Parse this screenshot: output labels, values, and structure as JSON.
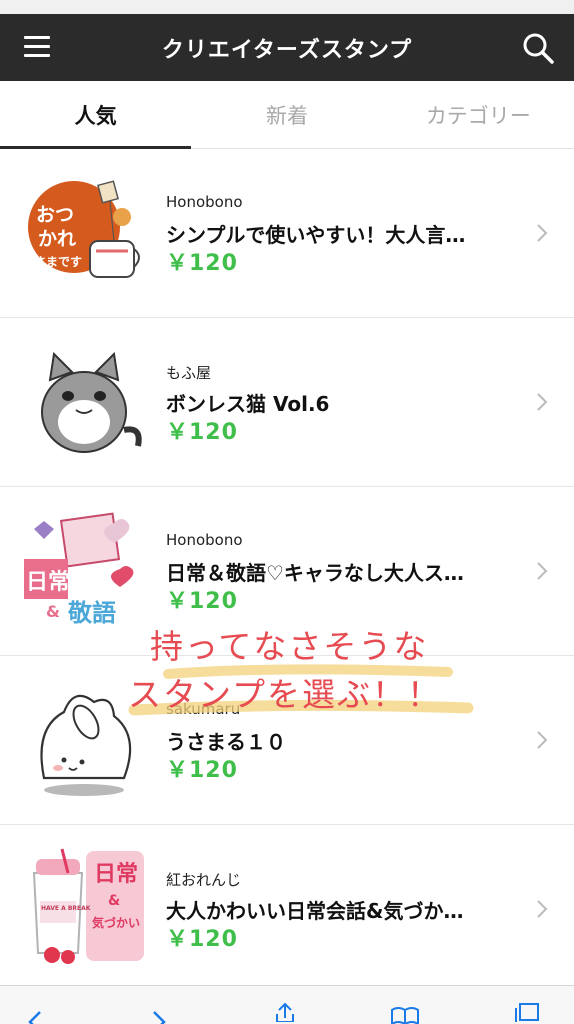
{
  "header": {
    "title": "クリエイターズスタンプ",
    "menu_icon": "hamburger-menu-icon",
    "search_icon": "search-icon",
    "background": "#2b2b2b"
  },
  "tabs": [
    {
      "label": "人気",
      "active": true
    },
    {
      "label": "新着",
      "active": false
    },
    {
      "label": "カテゴリー",
      "active": false
    }
  ],
  "stickers": [
    {
      "creator": "Honobono",
      "title": "シンプルで使いやすい！大人言…",
      "price": "￥120",
      "thumbnail": "otsukaresama-cup-sticker"
    },
    {
      "creator": "もふ屋",
      "title": "ボンレス猫 Vol.6",
      "price": "￥120",
      "thumbnail": "gray-cat-sticker"
    },
    {
      "creator": "Honobono",
      "title": "日常＆敬語♡キャラなし大人ス…",
      "price": "￥120",
      "thumbnail": "nichijou-keigo-sticker",
      "thumbnail_text": [
        "日常",
        "&",
        "敬語"
      ]
    },
    {
      "creator": "sakumaru",
      "title": "うさまる１０",
      "price": "￥120",
      "thumbnail": "usamaru-rabbit-sticker"
    },
    {
      "creator": "紅おれんじ",
      "title": "大人かわいい日常会話&気づか…",
      "price": "￥120",
      "thumbnail": "nichijou-kizukai-sticker",
      "thumbnail_text": [
        "日常",
        "&",
        "気づかい",
        "HAVE A BREAK"
      ]
    }
  ],
  "overlay_note": {
    "line1": "持ってなさそうな",
    "line2": "スタンプを選ぶ！！",
    "text_color": "#e64b52",
    "highlight_color": "#f4d27a"
  },
  "colors": {
    "price": "#3fbf4a",
    "tab_active": "#111111",
    "tab_inactive": "#a9a9a9"
  },
  "bottom_bar": {
    "icons": [
      "back-arrow-icon",
      "forward-arrow-icon",
      "share-icon",
      "bookmarks-icon",
      "tabs-icon"
    ]
  }
}
